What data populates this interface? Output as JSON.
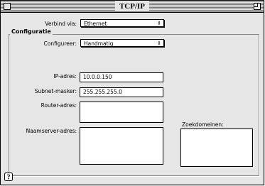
{
  "window": {
    "title": "TCP/IP"
  },
  "connect": {
    "label": "Verbind via:",
    "value": "Ethernet"
  },
  "config_group": {
    "title": "Configuratie"
  },
  "configure": {
    "label": "Configureer:",
    "value": "Handmatig"
  },
  "ip": {
    "label": "IP-adres:",
    "value": "10.0.0.150"
  },
  "subnet": {
    "label": "Subnet-masker:",
    "value": "255.255.255.0"
  },
  "router": {
    "label": "Router-adres:",
    "value": ""
  },
  "dns": {
    "label": "Naamserver-adres:",
    "value": ""
  },
  "search_domains": {
    "label": "Zoekdomeinen:",
    "value": ""
  },
  "help": {
    "symbol": "?"
  }
}
